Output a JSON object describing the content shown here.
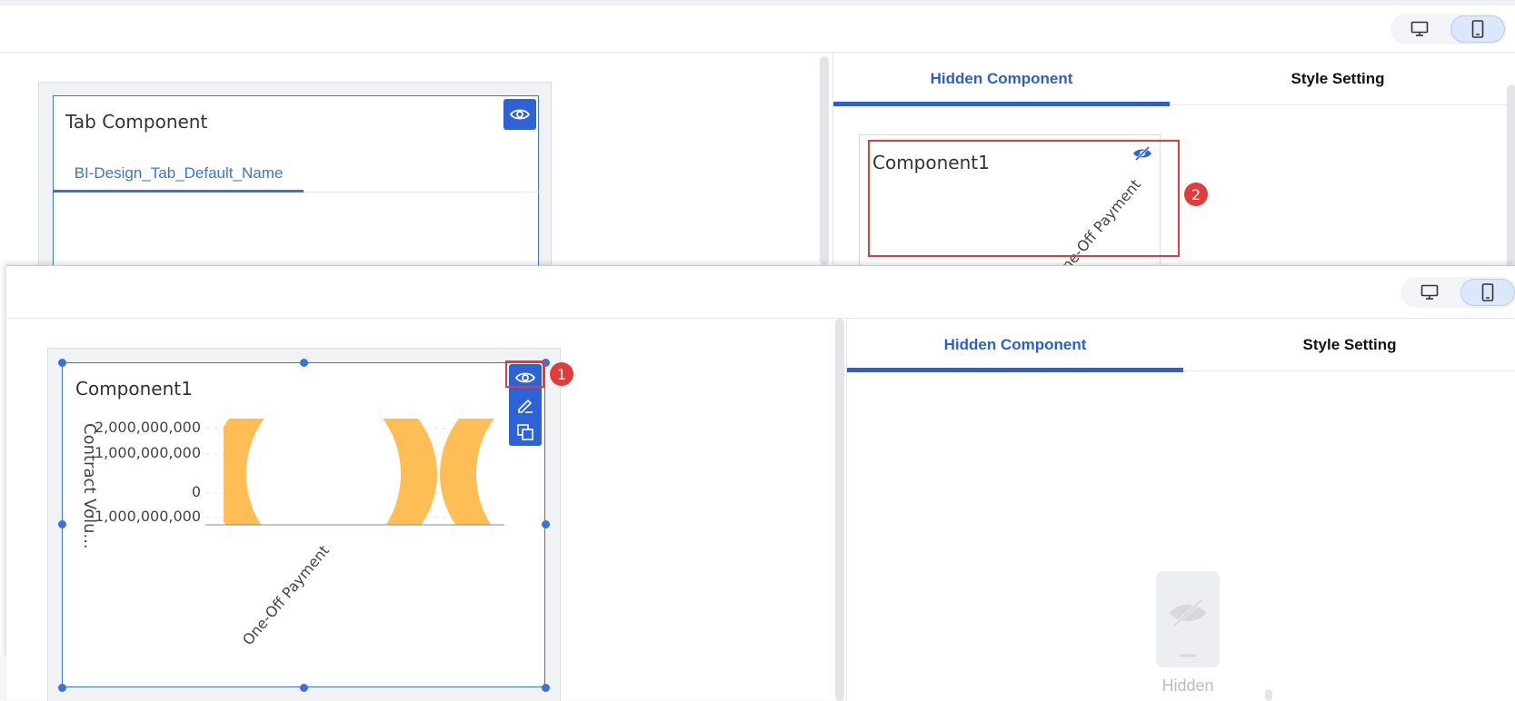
{
  "back": {
    "card_title": "Tab Component",
    "tab_label": "BI-Design_Tab_Default_Name",
    "right_tabs": [
      {
        "label": "Hidden Component"
      },
      {
        "label": "Style Setting"
      }
    ],
    "hidden_item": {
      "title": "Component1",
      "xlabel": "One-Off Payment"
    },
    "badge": "2"
  },
  "front": {
    "component_title": "Component1",
    "badge": "1",
    "right_tabs": [
      {
        "label": "Hidden Component"
      },
      {
        "label": "Style Setting"
      }
    ],
    "empty_state_label": "Hidden"
  },
  "chart_data": {
    "type": "bar",
    "title": "Component1",
    "categories": [
      "One-Off Payment"
    ],
    "ylabel": "Contract Volu...",
    "yticks": [
      "2,000,000,000",
      "1,000,000,000",
      "0",
      "-1,000,000,000"
    ],
    "ylim": [
      -1000000000,
      2000000000
    ],
    "series_color": "#ffbe55"
  },
  "colors": {
    "accent": "#2d5fcc",
    "alert": "#e13b3b",
    "bar": "#ffbe55"
  },
  "icons": [
    "desktop-icon",
    "mobile-icon",
    "eye-icon",
    "eye-off-icon",
    "edit-icon",
    "copy-icon",
    "hidden-phone-icon"
  ]
}
